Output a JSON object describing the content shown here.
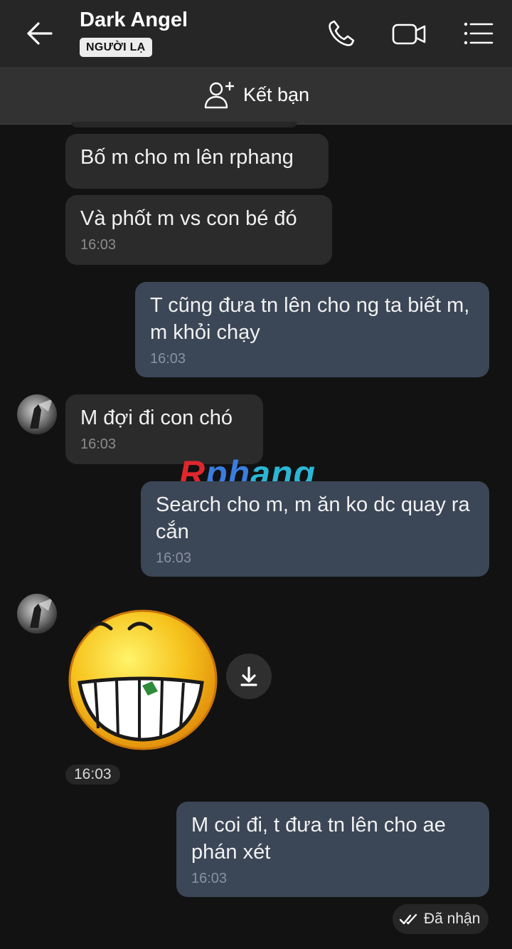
{
  "header": {
    "contact_name": "Dark Angel",
    "badge": "NGƯỜI LẠ",
    "back_icon": "back-arrow-icon",
    "call_icon": "phone-icon",
    "video_icon": "video-camera-icon",
    "menu_icon": "list-menu-icon"
  },
  "friend_bar": {
    "label": "Kết bạn",
    "icon": "add-person-icon"
  },
  "messages": [
    {
      "direction": "in",
      "text": "Bố m cho m lên rphang",
      "time": ""
    },
    {
      "direction": "in",
      "text": "Và phốt m vs con bé đó",
      "time": "16:03"
    },
    {
      "direction": "out",
      "text": "T cũng đưa tn lên cho ng ta biết m, m khỏi chạy",
      "time": "16:03"
    },
    {
      "direction": "in",
      "text": "M đợi đi con chó",
      "time": "16:03"
    },
    {
      "direction": "out",
      "text": "Search cho m, m ăn ko dc quay ra cắn",
      "time": "16:03"
    },
    {
      "direction": "in",
      "type": "sticker",
      "icon": "grinning-emoji-sticker",
      "time": "16:03"
    },
    {
      "direction": "out",
      "text": "M coi đi, t đưa tn lên cho ae phán xét",
      "time": "16:03"
    }
  ],
  "watermark": "Rphang",
  "status": {
    "label": "Đã nhận",
    "icon": "double-check-icon"
  },
  "colors": {
    "background": "#121212",
    "incoming_bubble": "#2b2b2b",
    "outgoing_bubble": "#3b4656",
    "header": "#262626"
  }
}
